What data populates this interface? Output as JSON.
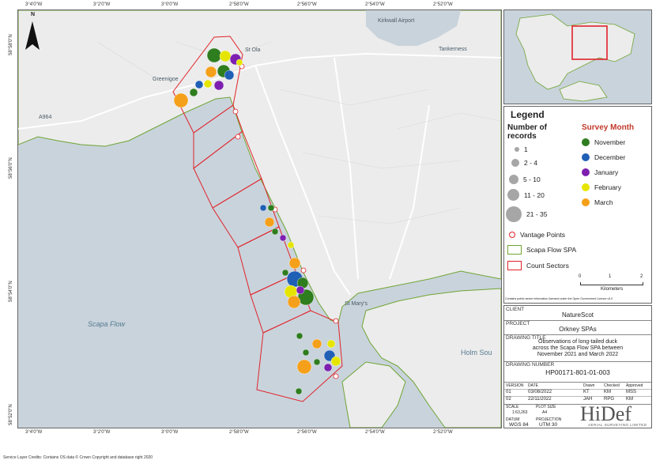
{
  "map": {
    "lon_ticks": [
      "3°4'0\"W",
      "3°2'0\"W",
      "3°0'0\"W",
      "2°58'0\"W",
      "2°56'0\"W",
      "2°54'0\"W",
      "2°52'0\"W"
    ],
    "lat_ticks": [
      "58°58'0\"N",
      "58°56'0\"N",
      "58°54'0\"N",
      "58°52'0\"N"
    ],
    "place_labels": {
      "kirkwall_airport": "Kirkwall Airport",
      "tankerness": "Tankerness",
      "st_ola": "St Ola",
      "greenigoe": "Greenigoe",
      "a964": "A964",
      "st_marys": "St Mary's",
      "scapa_flow": "Scapa Flow",
      "holm_sound": "Holm Sou"
    },
    "north_label": "N",
    "colors": {
      "sea": "#c9d3dc",
      "land": "#ececec",
      "roads": "#ffffff",
      "sectors": "#e0232a",
      "spa": "#6fa534"
    }
  },
  "legend": {
    "title": "Legend",
    "records_title": "Number of records",
    "size_classes": [
      "1",
      "2 - 4",
      "5 - 10",
      "11 - 20",
      "21 - 35"
    ],
    "month_title": "Survey Month",
    "months": [
      {
        "label": "November",
        "color": "#2e7d1e"
      },
      {
        "label": "December",
        "color": "#1f5fb5"
      },
      {
        "label": "January",
        "color": "#7d1fb0"
      },
      {
        "label": "February",
        "color": "#e5e500"
      },
      {
        "label": "March",
        "color": "#f5a01a"
      }
    ],
    "vantage_label": "Vantage Points",
    "spa_label": "Scapa Flow SPA",
    "sectors_label": "Count Sectors",
    "scale_ticks": [
      "0",
      "1",
      "2"
    ],
    "scale_unit": "Kilometers",
    "licence": "Contains public sector information licensed under the Open Government Licence v3.0"
  },
  "titleblock": {
    "client_label": "CLIENT",
    "client": "NatureScot",
    "project_label": "PROJECT",
    "project": "Orkney SPAs",
    "drawing_title_label": "DRAWING TITLE",
    "drawing_title_1": "Observations of long-tailed duck",
    "drawing_title_2": "across the Scapa Flow SPA between",
    "drawing_title_3": "November 2021 and March 2022",
    "drawing_number_label": "DRAWING NUMBER",
    "drawing_number": "HP00171-801-01-003",
    "rev_headers": [
      "VERSION",
      "DATE",
      "",
      "Drawn",
      "Checked",
      "Approved"
    ],
    "revs": [
      [
        "01",
        "03/08/2022",
        "",
        "KT",
        "KM",
        "MSS"
      ],
      [
        "02",
        "22/11/2022",
        "",
        "JAH",
        "RPG",
        "KM"
      ]
    ],
    "scale_label": "SCALE",
    "scale": "1:63,263",
    "plot_size_label": "PLOT SIZE",
    "plot_size": "A4",
    "datum_label": "DATUM",
    "datum": "WGS 84",
    "projection_label": "PROJECTION",
    "projection": "UTM 30",
    "logo": "HiDef",
    "logo_sub": "AERIAL SURVEYING LIMITED"
  },
  "credits": "Service Layer Credits: Contains OS data © Crown Copyright and database right 2020"
}
